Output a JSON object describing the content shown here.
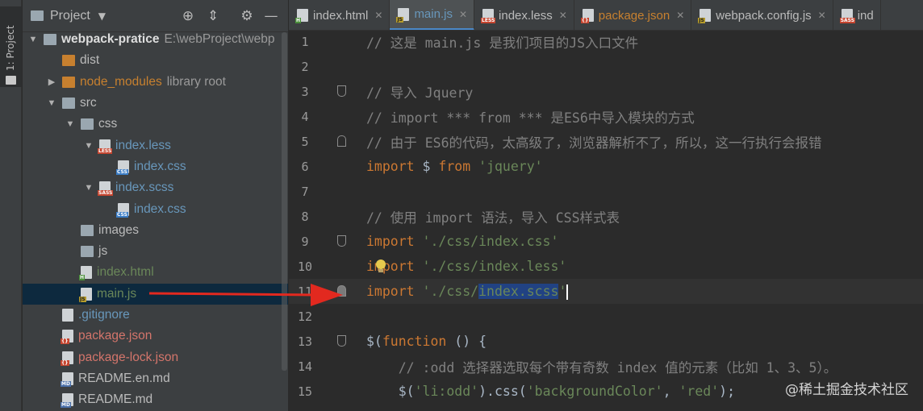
{
  "toolstrip": {
    "label": "1: Project"
  },
  "project_panel": {
    "title": "Project",
    "tree": [
      {
        "label": "webpack-pratice",
        "sub": "E:\\webProject\\webp",
        "indent": 0,
        "arrow": "open",
        "icon": "folder",
        "style": "bold"
      },
      {
        "label": "dist",
        "indent": 1,
        "arrow": "none",
        "icon": "folder-orange",
        "style": ""
      },
      {
        "label": "node_modules",
        "sub": "library root",
        "indent": 1,
        "arrow": "closed",
        "icon": "folder-orange",
        "style": "orange"
      },
      {
        "label": "src",
        "indent": 1,
        "arrow": "open",
        "icon": "folder",
        "style": ""
      },
      {
        "label": "css",
        "indent": 2,
        "arrow": "open",
        "icon": "folder",
        "style": ""
      },
      {
        "label": "index.less",
        "indent": 3,
        "arrow": "open",
        "icon": "less",
        "style": "blue"
      },
      {
        "label": "index.css",
        "indent": 4,
        "arrow": "none",
        "icon": "css",
        "style": "blue"
      },
      {
        "label": "index.scss",
        "indent": 3,
        "arrow": "open",
        "icon": "sass",
        "style": "blue"
      },
      {
        "label": "index.css",
        "indent": 4,
        "arrow": "none",
        "icon": "css",
        "style": "blue"
      },
      {
        "label": "images",
        "indent": 2,
        "arrow": "none",
        "icon": "folder",
        "style": ""
      },
      {
        "label": "js",
        "indent": 2,
        "arrow": "none",
        "icon": "folder",
        "style": ""
      },
      {
        "label": "index.html",
        "indent": 2,
        "arrow": "none",
        "icon": "html",
        "style": "green"
      },
      {
        "label": "main.js",
        "indent": 2,
        "arrow": "none",
        "icon": "js",
        "style": "green",
        "selected": true
      },
      {
        "label": ".gitignore",
        "indent": 1,
        "arrow": "none",
        "icon": "file",
        "style": "blue"
      },
      {
        "label": "package.json",
        "indent": 1,
        "arrow": "none",
        "icon": "json",
        "style": "red"
      },
      {
        "label": "package-lock.json",
        "indent": 1,
        "arrow": "none",
        "icon": "json",
        "style": "red"
      },
      {
        "label": "README.en.md",
        "indent": 1,
        "arrow": "none",
        "icon": "md",
        "style": ""
      },
      {
        "label": "README.md",
        "indent": 1,
        "arrow": "none",
        "icon": "md",
        "style": ""
      }
    ]
  },
  "tabs": [
    {
      "label": "index.html",
      "icon": "html",
      "style": "",
      "active": false
    },
    {
      "label": "main.js",
      "icon": "js",
      "style": "blue",
      "active": true
    },
    {
      "label": "index.less",
      "icon": "less",
      "style": "",
      "active": false
    },
    {
      "label": "package.json",
      "icon": "json",
      "style": "orange",
      "active": false
    },
    {
      "label": "webpack.config.js",
      "icon": "js",
      "style": "",
      "active": false
    },
    {
      "label": "ind",
      "icon": "sass",
      "style": "",
      "active": false
    }
  ],
  "code_lines": [
    {
      "n": "1",
      "parts": [
        [
          "cmt",
          "// 这是 main.js 是我们项目的JS入口文件"
        ]
      ]
    },
    {
      "n": "2",
      "parts": []
    },
    {
      "n": "3",
      "fold": "start",
      "parts": [
        [
          "cmt",
          "// 导入 Jquery"
        ]
      ]
    },
    {
      "n": "4",
      "parts": [
        [
          "cmt",
          "// import *** from *** 是ES6中导入模块的方式"
        ]
      ]
    },
    {
      "n": "5",
      "fold": "end",
      "parts": [
        [
          "cmt",
          "// 由于 ES6的代码，太高级了，浏览器解析不了，所以，这一行执行会报错"
        ]
      ]
    },
    {
      "n": "6",
      "parts": [
        [
          "kw",
          "import"
        ],
        [
          "",
          " $ "
        ],
        [
          "kw",
          "from"
        ],
        [
          "",
          " "
        ],
        [
          "str",
          "'jquery'"
        ]
      ]
    },
    {
      "n": "7",
      "parts": []
    },
    {
      "n": "8",
      "parts": [
        [
          "cmt",
          "// 使用 import 语法，导入 CSS样式表"
        ]
      ]
    },
    {
      "n": "9",
      "fold": "start",
      "parts": [
        [
          "kw",
          "import"
        ],
        [
          "",
          " "
        ],
        [
          "str",
          "'./css/index.css'"
        ]
      ]
    },
    {
      "n": "10",
      "parts": [
        [
          "kw",
          "import"
        ],
        [
          "",
          " "
        ],
        [
          "str",
          "'./css/index.less'"
        ]
      ]
    },
    {
      "n": "11",
      "fold": "end-filled",
      "current": true,
      "parts": [
        [
          "kw",
          "import"
        ],
        [
          "",
          " "
        ],
        [
          "str",
          "'./css/"
        ],
        [
          "str sel",
          "index.scss"
        ],
        [
          "str",
          "'"
        ],
        [
          "caret",
          ""
        ]
      ]
    },
    {
      "n": "12",
      "parts": []
    },
    {
      "n": "13",
      "fold": "start",
      "parts": [
        [
          "",
          "$("
        ],
        [
          "kw",
          "function"
        ],
        [
          "",
          " () {"
        ]
      ]
    },
    {
      "n": "14",
      "parts": [
        [
          "cmt",
          "    // :odd 选择器选取每个带有奇数 index 值的元素（比如 1、3、5）。"
        ]
      ]
    },
    {
      "n": "15",
      "parts": [
        [
          "",
          "    $("
        ],
        [
          "str",
          "'li:odd'"
        ],
        [
          "",
          ").css("
        ],
        [
          "str",
          "'backgroundColor'"
        ],
        [
          "",
          ", "
        ],
        [
          "str",
          "'red'"
        ],
        [
          "",
          ");"
        ]
      ]
    }
  ],
  "watermark": "@稀土掘金技术社区",
  "colors": {
    "accent": "#4a88c7",
    "keyword": "#cc7832",
    "string": "#6a8759",
    "comment": "#808080",
    "arrow": "#e2291f"
  }
}
